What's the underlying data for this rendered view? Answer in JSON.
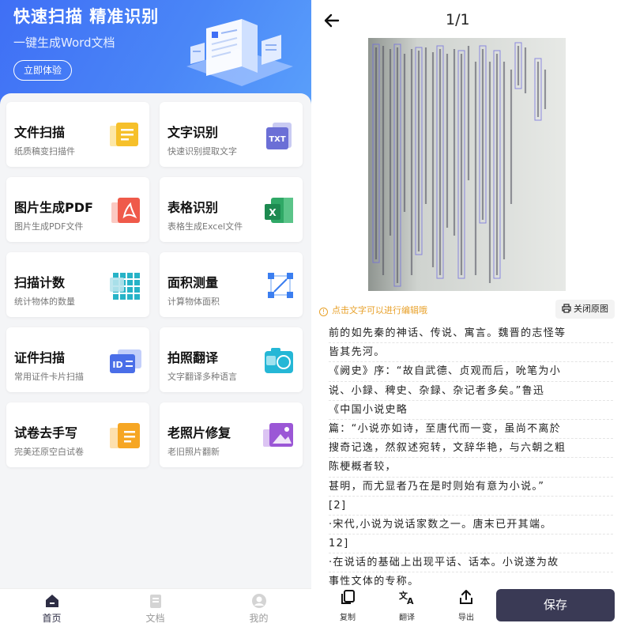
{
  "banner": {
    "title": "快速扫描 精准识别",
    "subtitle": "一键生成Word文档",
    "button": "立即体验"
  },
  "tools": [
    {
      "title": "文件扫描",
      "desc": "纸质稿变扫描件",
      "icon": "document-scan-icon",
      "color": "#f6c02a"
    },
    {
      "title": "文字识别",
      "desc": "快速识别提取文字",
      "icon": "txt-file-icon",
      "color": "#6b6fd6"
    },
    {
      "title": "图片生成PDF",
      "desc": "图片生成PDF文件",
      "icon": "pdf-file-icon",
      "color": "#ef5a4a"
    },
    {
      "title": "表格识别",
      "desc": "表格生成Excel文件",
      "icon": "excel-file-icon",
      "color": "#2fa866"
    },
    {
      "title": "扫描计数",
      "desc": "统计物体的数量",
      "icon": "count-grid-icon",
      "color": "#27b3c7"
    },
    {
      "title": "面积测量",
      "desc": "计算物体面积",
      "icon": "area-measure-icon",
      "color": "#3b7ef0"
    },
    {
      "title": "证件扫描",
      "desc": "常用证件卡片扫描",
      "icon": "id-card-icon",
      "color": "#4a6ee8"
    },
    {
      "title": "拍照翻译",
      "desc": "文字翻译多种语言",
      "icon": "translate-camera-icon",
      "color": "#25b7d6"
    },
    {
      "title": "试卷去手写",
      "desc": "完美还原空白试卷",
      "icon": "exam-paper-icon",
      "color": "#f6a623"
    },
    {
      "title": "老照片修复",
      "desc": "老旧照片翻新",
      "icon": "photo-restore-icon",
      "color": "#9b57d6"
    }
  ],
  "tabbar": [
    {
      "label": "首页",
      "icon": "home-icon",
      "active": true
    },
    {
      "label": "文档",
      "icon": "document-icon",
      "active": false
    },
    {
      "label": "我的",
      "icon": "user-icon",
      "active": false
    }
  ],
  "viewer": {
    "page_counter": "1/1",
    "hint": "点击文字可以进行编辑哦",
    "close_original": "关闭原图",
    "ocr_lines": [
      "前的如先秦的神话、传说、寓言。魏晋的志怪等",
      "皆其先河。",
      "《阙史》序：“故自武德、贞观而后，吮笔为小",
      "说、小録、稗史、杂録、杂记者多矣。”鲁迅",
      "《中国小说史略",
      "篇：“小说亦如诗，至唐代而一变，虽尚不离於",
      "搜奇记逸，然叙述宛转，文辞华艳，与六朝之粗",
      "陈梗概者较，",
      "甚明，而尤显者乃在是时则始有意为小说。”",
      "[2]",
      "·宋代,小说为说话家数之一。唐末已开其端。",
      "12]",
      "·在说话的基础上出现平话、话本。小说遂为故",
      "事性文体的专称。"
    ],
    "actions": [
      {
        "label": "复制",
        "icon": "copy-icon"
      },
      {
        "label": "翻译",
        "icon": "translate-icon"
      },
      {
        "label": "导出",
        "icon": "export-icon"
      }
    ],
    "save": "保存"
  }
}
